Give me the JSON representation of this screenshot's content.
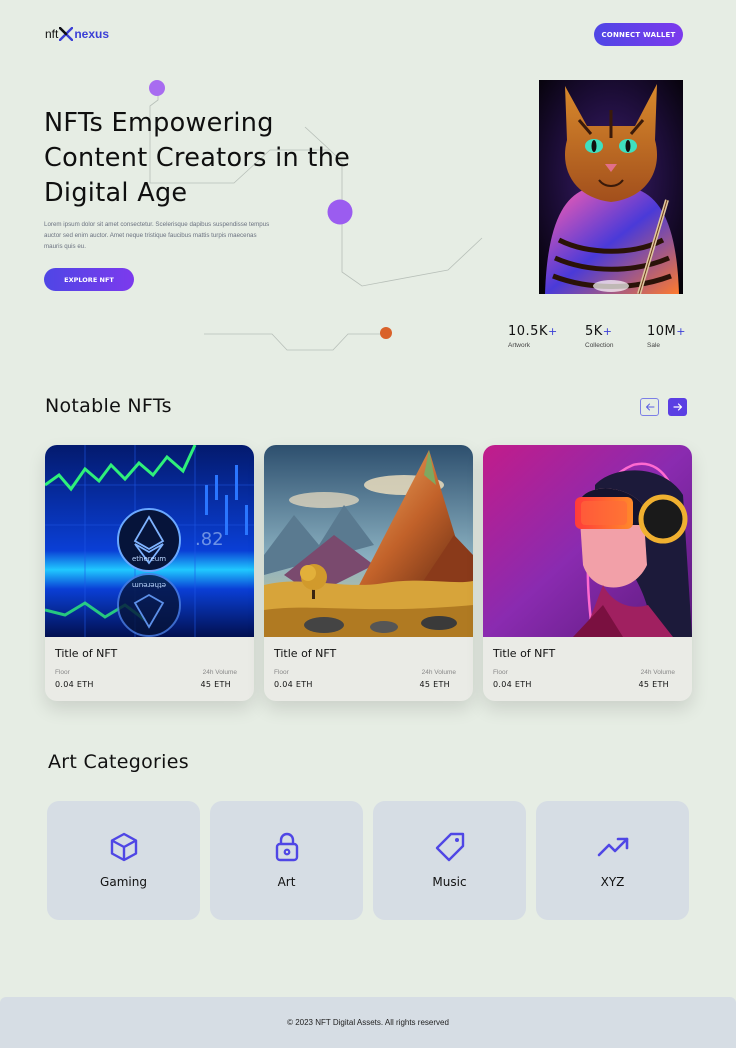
{
  "header": {
    "logo_prefix": "nft",
    "logo_suffix": "nexus",
    "connect_label": "CONNECT WALLET"
  },
  "hero": {
    "title_lines": [
      "NFTs Empowering",
      "Content Creators in the",
      "Digital Age"
    ],
    "description": "Lorem ipsum dolor sit amet consectetur. Scelerisque dapibus suspendisse tempus auctor sed enim auctor. Amet neque tristique faucibus mattis turpis maecenas mauris quis eu.",
    "explore_label": "EXPLORE NFT",
    "image_icon": "cat-artwork"
  },
  "stats": [
    {
      "value": "10.5K",
      "plus": "+",
      "label": "Artwork"
    },
    {
      "value": "5K",
      "plus": "+",
      "label": "Collection"
    },
    {
      "value": "10M",
      "plus": "+",
      "label": "Sale"
    }
  ],
  "notable": {
    "title": "Notable NFTs",
    "prev_icon": "arrow-left-icon",
    "next_icon": "arrow-right-icon",
    "cards": [
      {
        "title": "Title of NFT",
        "floor_label": "Floor",
        "floor_value": "0.04 ETH",
        "volume_label": "24h Volume",
        "volume_value": "45 ETH",
        "image_icon": "ethereum-chart-image",
        "coin_text": "ethereum",
        "coin_text_mirror": "ethereum"
      },
      {
        "title": "Title of NFT",
        "floor_label": "Floor",
        "floor_value": "0.04 ETH",
        "volume_label": "24h Volume",
        "volume_value": "45 ETH",
        "image_icon": "mountain-landscape-image"
      },
      {
        "title": "Title of NFT",
        "floor_label": "Floor",
        "floor_value": "0.04 ETH",
        "volume_label": "24h Volume",
        "volume_value": "45 ETH",
        "image_icon": "vr-girl-image"
      }
    ]
  },
  "categories": {
    "title": "Art Categories",
    "items": [
      {
        "label": "Gaming",
        "icon": "cube-icon"
      },
      {
        "label": "Art",
        "icon": "lock-icon"
      },
      {
        "label": "Music",
        "icon": "tag-icon"
      },
      {
        "label": "XYZ",
        "icon": "trending-up-icon"
      }
    ]
  },
  "footer": {
    "text": "© 2023 NFT Digital Assets. All rights reserved"
  },
  "colors": {
    "background": "#e6ede4",
    "accent": "#4f46e5",
    "accent2": "#7c3aed",
    "card": "#d6dde4"
  }
}
